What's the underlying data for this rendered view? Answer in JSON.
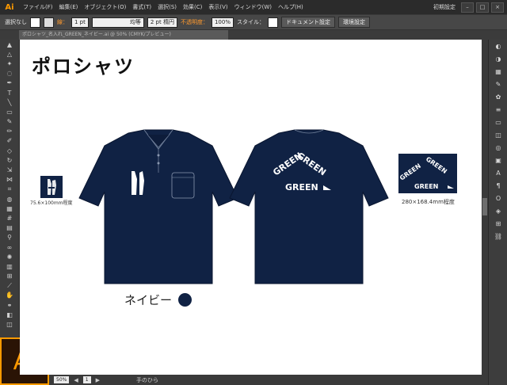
{
  "menubar": {
    "app_badge": "Ai",
    "items": [
      "ファイル(F)",
      "編集(E)",
      "オブジェクト(O)",
      "書式(T)",
      "選択(S)",
      "効果(C)",
      "表示(V)",
      "ウィンドウ(W)",
      "ヘルプ(H)"
    ],
    "workspace": "初期設定"
  },
  "control": {
    "selection": "選択なし",
    "stroke_label": "線：",
    "stroke_width": "1 pt",
    "stroke_style": "均等",
    "brush": "2 pt 楕円",
    "opacity_label": "不透明度：",
    "opacity_value": "100%",
    "style_label": "スタイル：",
    "doc_settings": "ドキュメント設定",
    "prefs": "環境設定"
  },
  "document": {
    "tab_name": "ポロシャツ_名入れ_GREEN_ネイビー.ai @ 50% (CMYK/プレビュー)"
  },
  "artboard": {
    "title": "ポロシャツ",
    "small_logo_label": "75.6×100mm程度",
    "large_logo_label": "280×168.4mm程度",
    "color_name": "ネイビー",
    "logo_words": [
      "GREEN",
      "GREEN",
      "GREEN"
    ]
  },
  "status": {
    "zoom": "50%",
    "page": "1",
    "tool": "手のひら"
  },
  "colors": {
    "navy": "#102244",
    "accent": "#ff9a00"
  }
}
